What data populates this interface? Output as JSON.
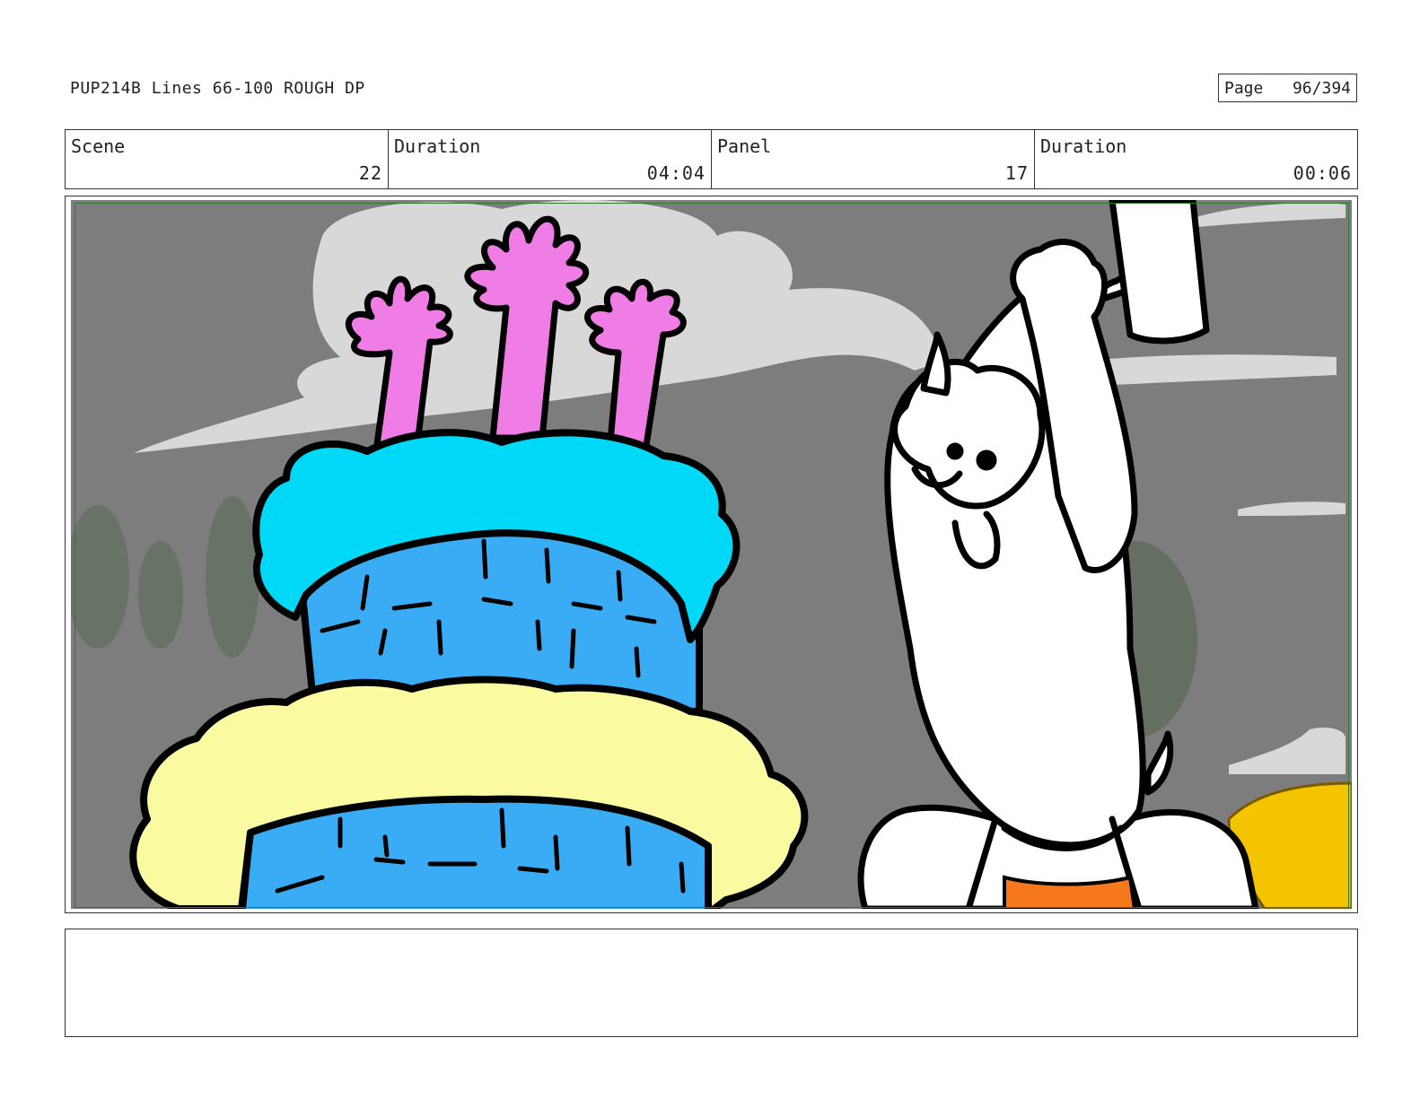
{
  "header": {
    "title": "PUP214B Lines 66-100 ROUGH DP",
    "page_label": "Page",
    "page_number": "96/394"
  },
  "info": {
    "scene_label": "Scene",
    "scene_value": "22",
    "scene_duration_label": "Duration",
    "scene_duration_value": "04:04",
    "panel_label": "Panel",
    "panel_value": "17",
    "panel_duration_label": "Duration",
    "panel_duration_value": "00:06"
  },
  "notes": {
    "text": ""
  },
  "colors": {
    "sky": "#7d7d7d",
    "cloud": "#d8d8d8",
    "candle": "#f07ce6",
    "frosting_top": "#00d8f8",
    "cake_blue": "#3aacf6",
    "frosting_bottom": "#fafaa0",
    "shorts": "#f7791b",
    "gift_yellow": "#f5c400",
    "bush": "#5c6a58",
    "safe_guide": "#2f7a2f"
  }
}
